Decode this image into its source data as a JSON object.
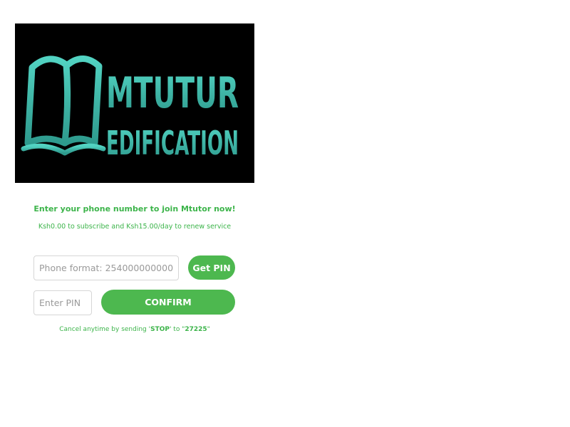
{
  "logo": {
    "line1": "MTUTUR",
    "line2": "EDIFICATION",
    "icon": "open-book-icon",
    "background": "#000000",
    "color": "#46c2b4"
  },
  "signup": {
    "headline": "Enter your phone number to join Mtutor now!",
    "pricing": "Ksh0.00 to subscribe and Ksh15.00/day to renew service",
    "phone_placeholder": "Phone format: 254000000000",
    "phone_value": "",
    "get_pin_label": "Get PIN",
    "pin_placeholder": "Enter PIN",
    "pin_value": "",
    "confirm_label": "CONFIRM",
    "cancel_prefix": "Cancel anytime by sending '",
    "cancel_keyword": "STOP",
    "cancel_middle": "' to \"",
    "cancel_shortcode": "27225",
    "cancel_suffix": "\""
  },
  "colors": {
    "accent_green": "#4db84f",
    "text_green": "#3cb44a"
  }
}
